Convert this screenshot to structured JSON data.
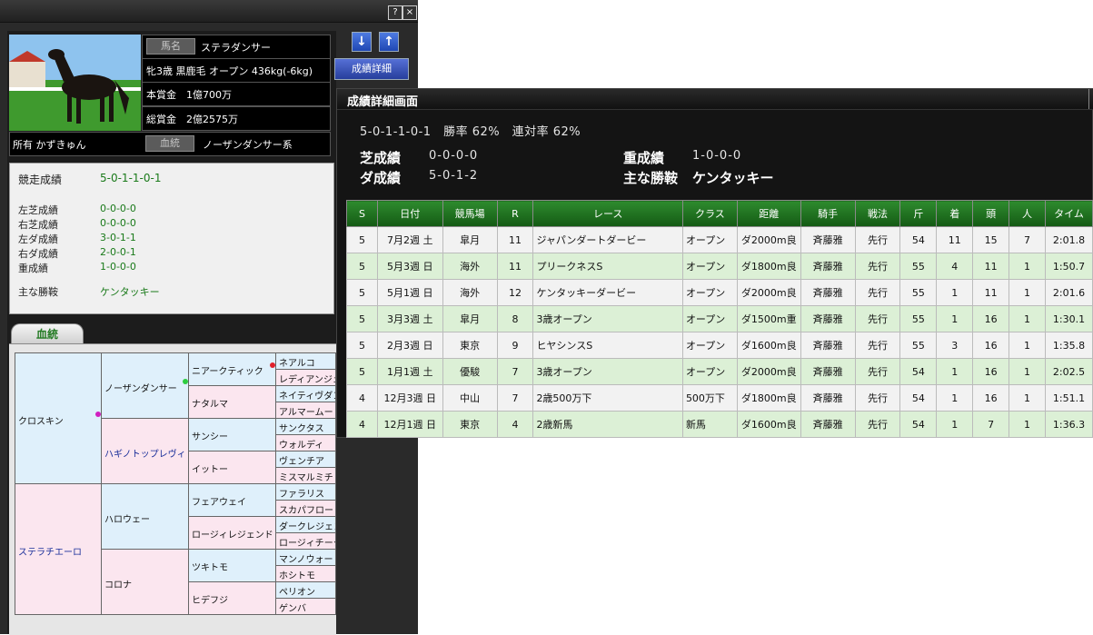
{
  "window": {
    "help_label": "?",
    "close_label": "×"
  },
  "horse": {
    "name_label": "馬名",
    "name": "ステラダンサー",
    "profile": "牝3歳 黒鹿毛 オープン 436kg(-6kg)",
    "prize_main": "本賞金　1億700万",
    "prize_total": "総賞金　2億2575万",
    "owner": "所有 かずきゅん",
    "lineage_label": "血統",
    "lineage": "ノーザンダンサー系"
  },
  "buttons": {
    "down": "↓",
    "up": "↑",
    "detail": "成績詳細"
  },
  "stats": {
    "record_label": "競走成績",
    "record_value": "5-0-1-1-0-1",
    "rows": [
      {
        "label": "左芝成績",
        "value": "0-0-0-0"
      },
      {
        "label": "右芝成績",
        "value": "0-0-0-0"
      },
      {
        "label": "左ダ成績",
        "value": "3-0-1-1"
      },
      {
        "label": "右ダ成績",
        "value": "2-0-0-1"
      },
      {
        "label": "重成績",
        "value": "1-0-0-0"
      }
    ],
    "main_win_label": "主な勝鞍",
    "main_win_value": "ケンタッキー"
  },
  "pedigree": {
    "tab_label": "血統",
    "sire": "クロスキン",
    "dam": "ステラチエーロ",
    "ss": "ノーザンダンサー",
    "sd": "ハギノトップレヴィ",
    "ds": "ハロウェー",
    "dd": "コロナ",
    "g3": [
      "ニアークティック",
      "ナタルマ",
      "サンシー",
      "イットー",
      "フェアウェイ",
      "ロージィレジェンド",
      "ツキトモ",
      "ヒデフジ"
    ],
    "g4": [
      "ネアルコ",
      "レディアンジェ",
      "ネイティヴダン",
      "アルマームード",
      "サンクタス",
      "ウォルディ",
      "ヴェンチア",
      "ミスマルミチ",
      "ファラリス",
      "スカパフロー",
      "ダークレジェン",
      "ロージィチークス",
      "マンノウォー",
      "ホシトモ",
      "ペリオン",
      "ゲンバ"
    ]
  },
  "detail": {
    "title": "成績詳細画面",
    "summary": "5-0-1-1-0-1　勝率 62%　連対率 62%",
    "turf_label": "芝成績",
    "turf_value": "0-0-0-0",
    "dirt_label": "ダ成績",
    "dirt_value": "5-0-1-2",
    "graded_label": "重成績",
    "graded_value": "1-0-0-0",
    "main_win_label": "主な勝鞍",
    "main_win_value": "ケンタッキー"
  },
  "table": {
    "headers": [
      "S",
      "日付",
      "競馬場",
      "R",
      "レース",
      "クラス",
      "距離",
      "騎手",
      "戦法",
      "斤",
      "着",
      "頭",
      "人",
      "タイム"
    ],
    "rows": [
      [
        "5",
        "7月2週 土",
        "皐月",
        "11",
        "ジャパンダートダービー",
        "オープン",
        "ダ2000m良",
        "斉藤雅",
        "先行",
        "54",
        "11",
        "15",
        "7",
        "2:01.8"
      ],
      [
        "5",
        "5月3週 日",
        "海外",
        "11",
        "プリークネスS",
        "オープン",
        "ダ1800m良",
        "斉藤雅",
        "先行",
        "55",
        "4",
        "11",
        "1",
        "1:50.7"
      ],
      [
        "5",
        "5月1週 日",
        "海外",
        "12",
        "ケンタッキーダービー",
        "オープン",
        "ダ2000m良",
        "斉藤雅",
        "先行",
        "55",
        "1",
        "11",
        "1",
        "2:01.6"
      ],
      [
        "5",
        "3月3週 土",
        "皐月",
        "8",
        "3歳オープン",
        "オープン",
        "ダ1500m重",
        "斉藤雅",
        "先行",
        "55",
        "1",
        "16",
        "1",
        "1:30.1"
      ],
      [
        "5",
        "2月3週 日",
        "東京",
        "9",
        "ヒヤシンスS",
        "オープン",
        "ダ1600m良",
        "斉藤雅",
        "先行",
        "55",
        "3",
        "16",
        "1",
        "1:35.8"
      ],
      [
        "5",
        "1月1週 土",
        "優駿",
        "7",
        "3歳オープン",
        "オープン",
        "ダ2000m良",
        "斉藤雅",
        "先行",
        "54",
        "1",
        "16",
        "1",
        "2:02.5"
      ],
      [
        "4",
        "12月3週 日",
        "中山",
        "7",
        "2歳500万下",
        "500万下",
        "ダ1800m良",
        "斉藤雅",
        "先行",
        "54",
        "1",
        "16",
        "1",
        "1:51.1"
      ],
      [
        "4",
        "12月1週 日",
        "東京",
        "4",
        "2歳新馬",
        "新馬",
        "ダ1600m良",
        "斉藤雅",
        "先行",
        "54",
        "1",
        "7",
        "1",
        "1:36.3"
      ]
    ]
  },
  "colors": {
    "header_green": "#1f7a1f",
    "row_green": "#dcf0d6",
    "button_blue": "#2b4fc0"
  }
}
